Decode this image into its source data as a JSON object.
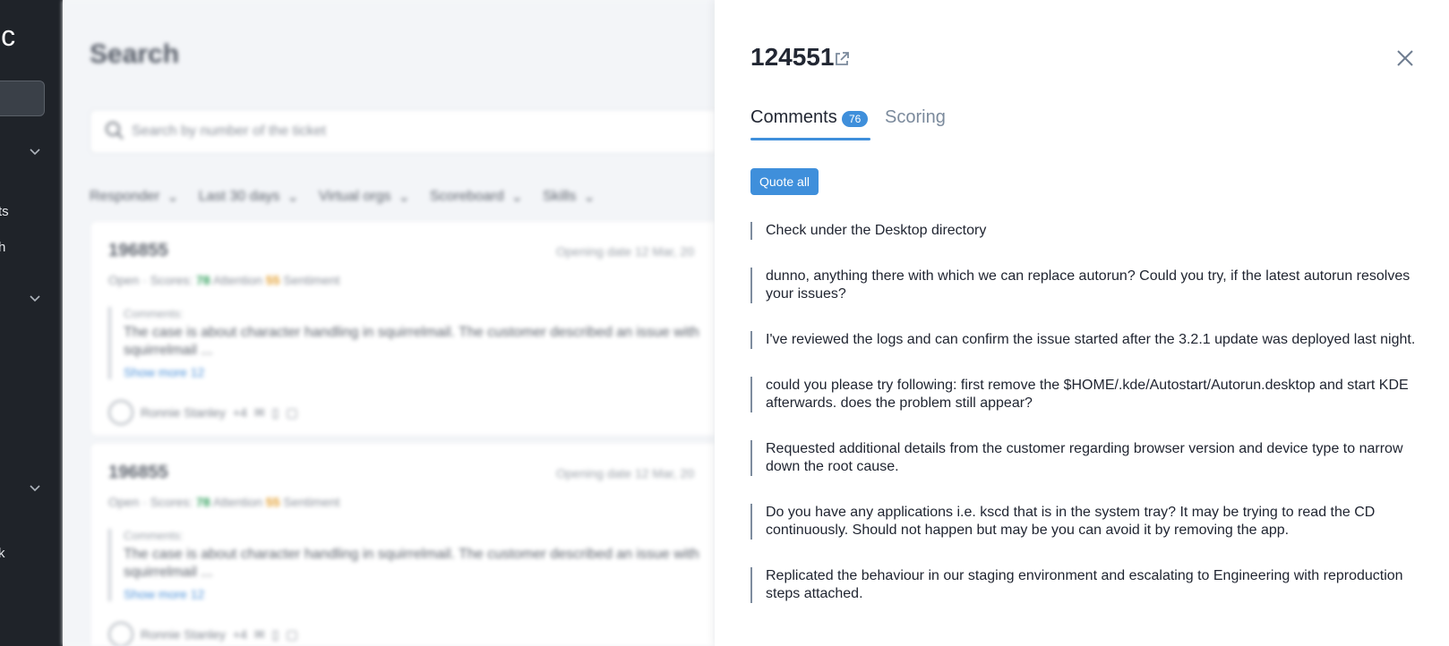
{
  "sidebar": {
    "logo_fragment": "ic",
    "item_fragments": [
      "ts",
      "h",
      "k"
    ],
    "icon_names": [
      "chevron-down-icon"
    ]
  },
  "background": {
    "page_title": "Search",
    "search_placeholder": "Search by number of the ticket",
    "filters": [
      "Responder",
      "Last 30 days",
      "Virtual orgs",
      "Scoreboard",
      "Skills"
    ],
    "cards": [
      {
        "number": "196855",
        "date": "Opening date 12 Mar, 20",
        "status": "Open",
        "scores_label": "Scores:",
        "attention_value": "78",
        "attention_label": "Attention",
        "sentiment_value": "55",
        "sentiment_label": "Sentiment",
        "comments_label": "Comments:",
        "comment_text": "The case is about character handling in squirrelmail. The customer described an issue with squirrelmail ...",
        "show_more": "Show more 12",
        "responder": "Ronnie Stanley",
        "extra": "+4"
      },
      {
        "number": "196855",
        "date": "Opening date 12 Mar, 20",
        "status": "Open",
        "scores_label": "Scores:",
        "attention_value": "78",
        "attention_label": "Attention",
        "sentiment_value": "55",
        "sentiment_label": "Sentiment",
        "comments_label": "Comments:",
        "comment_text": "The case is about character handling in squirrelmail. The customer described an issue with squirrelmail ...",
        "show_more": "Show more 12",
        "responder": "Ronnie Stanley",
        "extra": "+4"
      }
    ]
  },
  "panel": {
    "ticket_number": "124551",
    "tabs": {
      "comments_label": "Comments",
      "comments_count": "76",
      "scoring_label": "Scoring"
    },
    "quote_all_label": "Quote all",
    "comments": [
      "Check under the Desktop directory",
      "dunno, anything there with which we can replace autorun? Could you try, if the latest autorun resolves your issues?",
      "I've reviewed the logs and can confirm the issue started after the 3.2.1 update was deployed last night.",
      "could you please try following: first remove the $HOME/.kde/Autostart/Autorun.desktop and start KDE afterwards. does the problem still appear?",
      "Requested additional details from the customer regarding browser version and device type to narrow down the root cause.",
      "Do you have any applications i.e. kscd that is in the system tray? It may be trying to read the CD continuously. Should not happen but may be you can avoid it by removing the app.",
      "Replicated the behaviour in our staging environment and escalating to Engineering with reproduction steps attached."
    ],
    "colors": {
      "accent": "#3f8fdb",
      "quote_border": "#7e8c9e",
      "scoring_tab": "#7b8a9c"
    },
    "icons": [
      "external-link-icon",
      "close-icon"
    ]
  }
}
